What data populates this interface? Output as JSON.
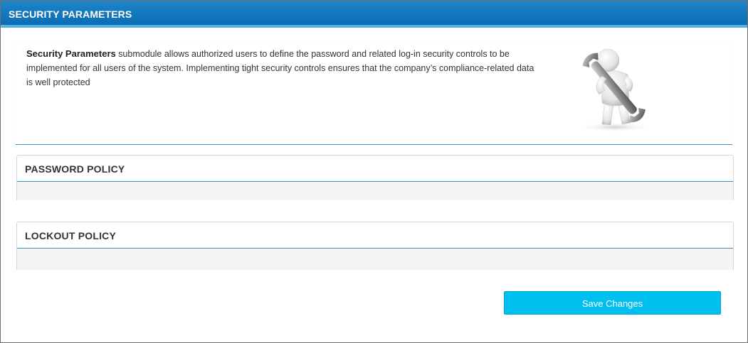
{
  "window": {
    "title": "SECURITY PARAMETERS"
  },
  "intro": {
    "bold_lead": "Security Parameters",
    "description": " submodule allows authorized users to define the password and related log-in security controls to be implemented for all users of the system. Implementing tight security controls ensures that the company’s compliance-related data is well protected",
    "illustration_icon": "person-with-wrench-icon"
  },
  "sections": {
    "password_policy": {
      "title": "PASSWORD POLICY"
    },
    "lockout_policy": {
      "title": "LOCKOUT POLICY"
    }
  },
  "actions": {
    "save_label": "Save Changes"
  },
  "colors": {
    "title_bar": "#0b6db3",
    "title_bar_accent": "#5bb0e2",
    "panel_rule": "#3a8fc7",
    "save_button": "#00c0ef",
    "text": "#333333",
    "panel_body": "#f5f5f5"
  }
}
